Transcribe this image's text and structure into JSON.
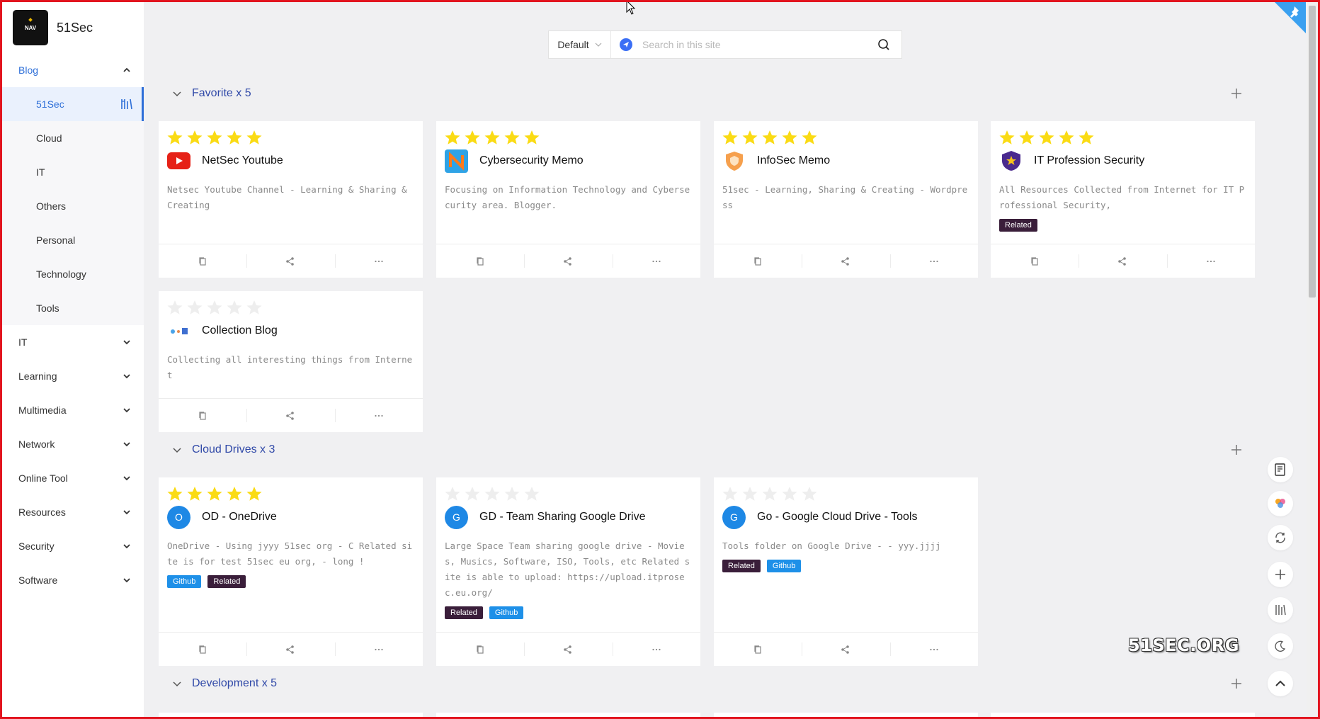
{
  "brand": {
    "logo_text": "NAV",
    "name": "51Sec"
  },
  "sidebar": {
    "open_group": "Blog",
    "sub_items": [
      "51Sec",
      "Cloud",
      "IT",
      "Others",
      "Personal",
      "Technology",
      "Tools"
    ],
    "groups": [
      "IT",
      "Learning",
      "Multimedia",
      "Network",
      "Online Tool",
      "Resources",
      "Security",
      "Software"
    ]
  },
  "search": {
    "selected": "Default",
    "placeholder": "Search in this site"
  },
  "sections": [
    {
      "title": "Favorite x 5"
    },
    {
      "title": "Cloud Drives x 3"
    },
    {
      "title": "Development x 5"
    }
  ],
  "cards": [
    {
      "title": "NetSec Youtube",
      "desc": "Netsec Youtube Channel - Learning & Sharing & Creating",
      "rating": 5,
      "icon": "youtube-icon",
      "tags": []
    },
    {
      "title": "Cybersecurity Memo",
      "desc": "Focusing on Information Technology and Cybersecurity area. Blogger.",
      "rating": 5,
      "icon": "netsec-n-icon",
      "tags": []
    },
    {
      "title": "InfoSec Memo",
      "desc": "51sec - Learning, Sharing & Creating - Wordpress",
      "rating": 5,
      "icon": "shield-icon",
      "tags": []
    },
    {
      "title": "IT Profession Security",
      "desc": "All Resources Collected from Internet for IT Professional Security,",
      "rating": 5,
      "icon": "star-badge-icon",
      "tags": [
        "Related"
      ]
    },
    {
      "title": "Collection Blog",
      "desc": "Collecting all interesting things from Internet",
      "rating": 0,
      "icon": "collection-icon",
      "tags": []
    },
    {
      "title": "OD - OneDrive",
      "desc": "OneDrive - Using jyyy 51sec org  - C Related site is for test 51sec eu org, - long !",
      "rating": 5,
      "icon_letter": "O",
      "tags": [
        "Github",
        "Related"
      ]
    },
    {
      "title": "GD - Team Sharing Google Drive",
      "desc": "Large Space Team sharing google drive - Movies, Musics, Software, ISO, Tools, etc Related site is able to upload: https://upload.itprosec.eu.org/",
      "rating": 0,
      "icon_letter": "G",
      "tags": [
        "Related",
        "Github"
      ]
    },
    {
      "title": "Go - Google Cloud Drive - Tools",
      "desc": "Tools folder on Google Drive -  - yyy.jjjj",
      "rating": 0,
      "icon_letter": "G",
      "tags": [
        "Related",
        "Github"
      ]
    }
  ],
  "watermark": "51SEC.ORG",
  "colors": {
    "accent": "#2e6fd8",
    "section": "#3049a8",
    "star_on": "#fadb14",
    "star_off": "#eeeeee",
    "tag_related": "#3a1e3a",
    "tag_github": "#1e90e8"
  }
}
